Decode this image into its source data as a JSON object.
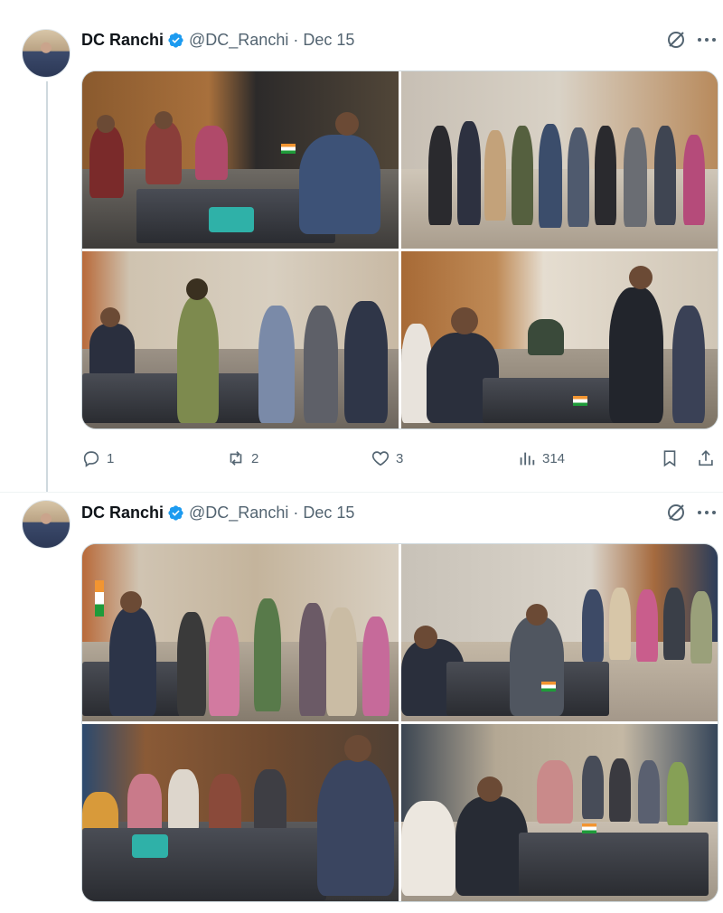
{
  "tweets": [
    {
      "author": {
        "name": "DC Ranchi",
        "handle": "@DC_Ranchi",
        "verified": true
      },
      "separator": "·",
      "date": "Dec 15",
      "photos": [
        "Officer at desk meeting seated visitors",
        "Queue of people holding papers in hall",
        "Officer at desk receiving applicants",
        "Officer speaking with person at desk"
      ],
      "stats": {
        "replies": "1",
        "reposts": "2",
        "likes": "3",
        "views": "314"
      }
    },
    {
      "author": {
        "name": "DC Ranchi",
        "handle": "@DC_Ranchi",
        "verified": true
      },
      "separator": "·",
      "date": "Dec 15",
      "photos": [
        "Line of visitors at officer's desk",
        "Officer shaking hands with visitor",
        "Officer at desk with seated visitors",
        "Officer signing papers with visitors"
      ]
    }
  ],
  "icons": {
    "verified": "verified-badge-icon",
    "grok": "grok-icon",
    "more": "more-options-icon",
    "reply": "reply-icon",
    "repost": "repost-icon",
    "like": "heart-icon",
    "views": "views-chart-icon",
    "bookmark": "bookmark-icon",
    "share": "share-icon"
  },
  "colors": {
    "verified": "#1d9bf0",
    "secondary_text": "#536471",
    "flag_saffron": "#f29531",
    "flag_green": "#1f9b3a"
  }
}
